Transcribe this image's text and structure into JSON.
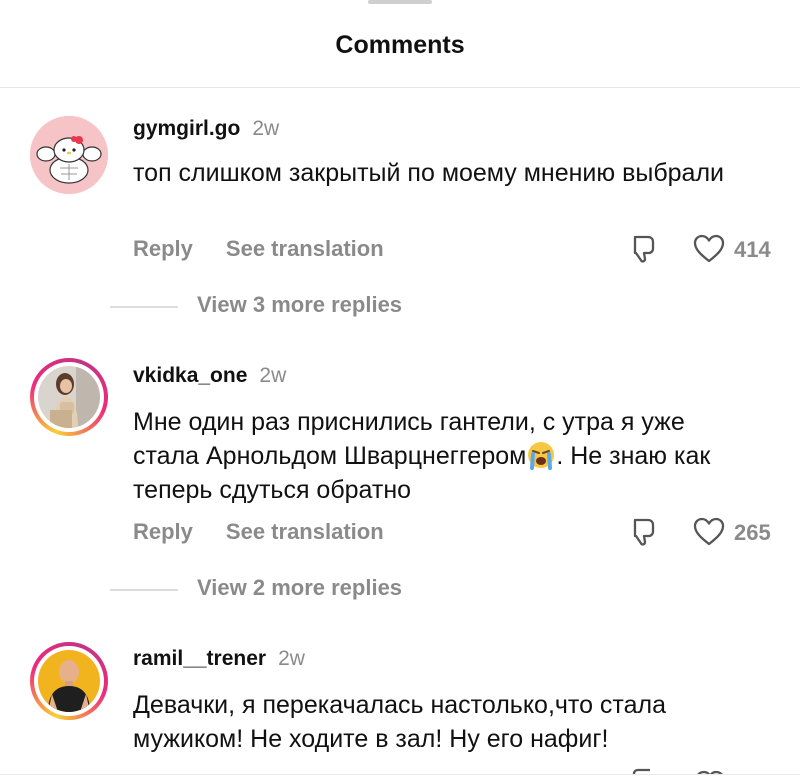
{
  "header": {
    "title": "Comments"
  },
  "comments": [
    {
      "username": "gymgirl.go",
      "time": "2w",
      "text": "топ слишком закрытый по моему мнению выбрали",
      "reply_label": "Reply",
      "translate_label": "See translation",
      "likes": "414",
      "view_replies": "View 3 more replies",
      "avatar": "hello-kitty-bodybuilder-avatar"
    },
    {
      "username": "vkidka_one",
      "time": "2w",
      "text_before_emoji": "Мне один раз приснились гантели, с утра я уже стала Арнольдом Шварцнеггером",
      "emoji": "loudly-crying-face-emoji",
      "text_after_emoji": ". Не знаю как теперь сдуться обратно",
      "reply_label": "Reply",
      "translate_label": "See translation",
      "likes": "265",
      "view_replies": "View 2 more replies",
      "avatar": "woman-photo-avatar"
    },
    {
      "username": "ramil__trener",
      "time": "2w",
      "text": "Девачки, я перекачалась настолько,что стала мужиком! Не ходите в зал! Ну его нафиг!",
      "avatar": "bald-man-photo-avatar"
    }
  ],
  "icons": {
    "dislike": "thumbs-down-icon",
    "like": "heart-icon"
  },
  "colors": {
    "text": "#111111",
    "muted": "#8a8a8a",
    "divider": "#e6e6e6",
    "story_ring": [
      "#f9ce34",
      "#ee2a7b",
      "#c13584"
    ]
  }
}
